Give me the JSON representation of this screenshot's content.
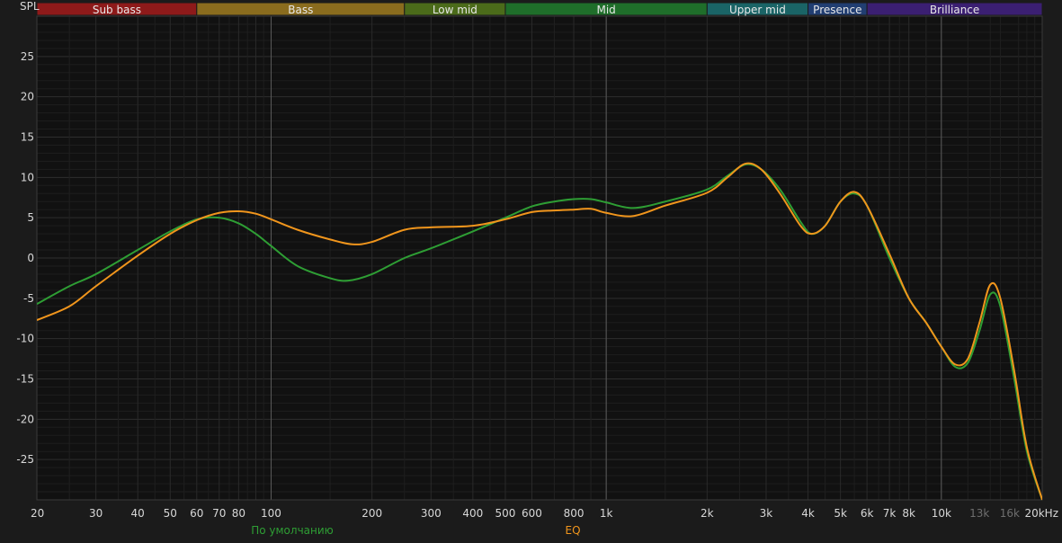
{
  "chart_data": {
    "type": "line",
    "ylabel": "SPL",
    "xscale": "log",
    "xlim": [
      20,
      20000
    ],
    "ylim": [
      -30,
      30
    ],
    "grid": true,
    "y_ticks": [
      {
        "value": 25,
        "label": "25"
      },
      {
        "value": 20,
        "label": "20"
      },
      {
        "value": 15,
        "label": "15"
      },
      {
        "value": 10,
        "label": "10"
      },
      {
        "value": 5,
        "label": "5"
      },
      {
        "value": 0,
        "label": "0"
      },
      {
        "value": -5,
        "label": "-5"
      },
      {
        "value": -10,
        "label": "-10"
      },
      {
        "value": -15,
        "label": "-15"
      },
      {
        "value": -20,
        "label": "-20"
      },
      {
        "value": -25,
        "label": "-25"
      }
    ],
    "x_ticks": [
      {
        "value": 20,
        "label": "20"
      },
      {
        "value": 30,
        "label": "30"
      },
      {
        "value": 40,
        "label": "40"
      },
      {
        "value": 50,
        "label": "50"
      },
      {
        "value": 60,
        "label": "60"
      },
      {
        "value": 70,
        "label": "70"
      },
      {
        "value": 80,
        "label": "80"
      },
      {
        "value": 100,
        "label": "100"
      },
      {
        "value": 200,
        "label": "200"
      },
      {
        "value": 300,
        "label": "300"
      },
      {
        "value": 400,
        "label": "400"
      },
      {
        "value": 500,
        "label": "500"
      },
      {
        "value": 600,
        "label": "600"
      },
      {
        "value": 800,
        "label": "800"
      },
      {
        "value": 1000,
        "label": "1k"
      },
      {
        "value": 2000,
        "label": "2k"
      },
      {
        "value": 3000,
        "label": "3k"
      },
      {
        "value": 4000,
        "label": "4k"
      },
      {
        "value": 5000,
        "label": "5k"
      },
      {
        "value": 6000,
        "label": "6k"
      },
      {
        "value": 7000,
        "label": "7k"
      },
      {
        "value": 8000,
        "label": "8k"
      },
      {
        "value": 10000,
        "label": "10k"
      },
      {
        "value": 13000,
        "label": "13k",
        "dim": true
      },
      {
        "value": 16000,
        "label": "16k",
        "dim": true
      },
      {
        "value": 20000,
        "label": "20kHz"
      }
    ],
    "major_gridlines_x": [
      100,
      1000,
      10000
    ],
    "bands": [
      {
        "name": "Sub bass",
        "from": 20,
        "to": 60,
        "color": "#8e1a1a"
      },
      {
        "name": "Bass",
        "from": 60,
        "to": 250,
        "color": "#8a6c1e"
      },
      {
        "name": "Low mid",
        "from": 250,
        "to": 500,
        "color": "#4b6b1a"
      },
      {
        "name": "Mid",
        "from": 500,
        "to": 2000,
        "color": "#1f6e2a"
      },
      {
        "name": "Upper mid",
        "from": 2000,
        "to": 4000,
        "color": "#1a6466"
      },
      {
        "name": "Presence",
        "from": 4000,
        "to": 6000,
        "color": "#213e72"
      },
      {
        "name": "Brilliance",
        "from": 6000,
        "to": 20000,
        "color": "#3b1f72"
      }
    ],
    "series": [
      {
        "name": "По умолчанию",
        "color": "#2e9e34",
        "points": [
          [
            20,
            -5.7
          ],
          [
            25,
            -3.5
          ],
          [
            30,
            -2.0
          ],
          [
            40,
            1.0
          ],
          [
            50,
            3.3
          ],
          [
            60,
            4.8
          ],
          [
            70,
            5.0
          ],
          [
            80,
            4.3
          ],
          [
            90,
            3.0
          ],
          [
            100,
            1.5
          ],
          [
            120,
            -1.0
          ],
          [
            150,
            -2.5
          ],
          [
            170,
            -2.8
          ],
          [
            200,
            -2.0
          ],
          [
            250,
            0.0
          ],
          [
            300,
            1.2
          ],
          [
            400,
            3.3
          ],
          [
            500,
            5.0
          ],
          [
            600,
            6.4
          ],
          [
            700,
            7.0
          ],
          [
            800,
            7.3
          ],
          [
            900,
            7.3
          ],
          [
            1000,
            6.9
          ],
          [
            1200,
            6.2
          ],
          [
            1500,
            7.0
          ],
          [
            2000,
            8.5
          ],
          [
            2300,
            10.2
          ],
          [
            2600,
            11.6
          ],
          [
            2900,
            11.0
          ],
          [
            3300,
            8.5
          ],
          [
            3800,
            4.5
          ],
          [
            4100,
            3.0
          ],
          [
            4500,
            4.0
          ],
          [
            5000,
            7.0
          ],
          [
            5500,
            8.0
          ],
          [
            6000,
            6.5
          ],
          [
            7000,
            0.0
          ],
          [
            8000,
            -5.0
          ],
          [
            9000,
            -8.0
          ],
          [
            10000,
            -11.0
          ],
          [
            11000,
            -13.5
          ],
          [
            12000,
            -13.0
          ],
          [
            13000,
            -9.0
          ],
          [
            14000,
            -4.5
          ],
          [
            15000,
            -6.0
          ],
          [
            16500,
            -15.0
          ],
          [
            18000,
            -24.0
          ],
          [
            20000,
            -30.0
          ]
        ]
      },
      {
        "name": "EQ",
        "color": "#f0951c",
        "points": [
          [
            20,
            -7.7
          ],
          [
            25,
            -6.0
          ],
          [
            30,
            -3.5
          ],
          [
            40,
            0.3
          ],
          [
            50,
            3.0
          ],
          [
            60,
            4.7
          ],
          [
            70,
            5.6
          ],
          [
            80,
            5.8
          ],
          [
            90,
            5.5
          ],
          [
            100,
            4.8
          ],
          [
            120,
            3.5
          ],
          [
            150,
            2.3
          ],
          [
            175,
            1.7
          ],
          [
            200,
            2.0
          ],
          [
            250,
            3.5
          ],
          [
            300,
            3.8
          ],
          [
            400,
            4.0
          ],
          [
            500,
            4.8
          ],
          [
            600,
            5.7
          ],
          [
            700,
            5.9
          ],
          [
            800,
            6.0
          ],
          [
            900,
            6.1
          ],
          [
            1000,
            5.6
          ],
          [
            1200,
            5.2
          ],
          [
            1500,
            6.5
          ],
          [
            2000,
            8.1
          ],
          [
            2300,
            10.0
          ],
          [
            2600,
            11.7
          ],
          [
            2900,
            11.0
          ],
          [
            3300,
            8.0
          ],
          [
            3800,
            4.0
          ],
          [
            4100,
            3.0
          ],
          [
            4500,
            4.0
          ],
          [
            5000,
            7.0
          ],
          [
            5500,
            8.2
          ],
          [
            6000,
            6.5
          ],
          [
            7000,
            0.5
          ],
          [
            8000,
            -5.0
          ],
          [
            9000,
            -8.0
          ],
          [
            10000,
            -11.0
          ],
          [
            11000,
            -13.2
          ],
          [
            12000,
            -12.5
          ],
          [
            13000,
            -8.0
          ],
          [
            14000,
            -3.3
          ],
          [
            15000,
            -5.0
          ],
          [
            16500,
            -14.0
          ],
          [
            18000,
            -23.5
          ],
          [
            20000,
            -30.0
          ]
        ]
      }
    ]
  }
}
